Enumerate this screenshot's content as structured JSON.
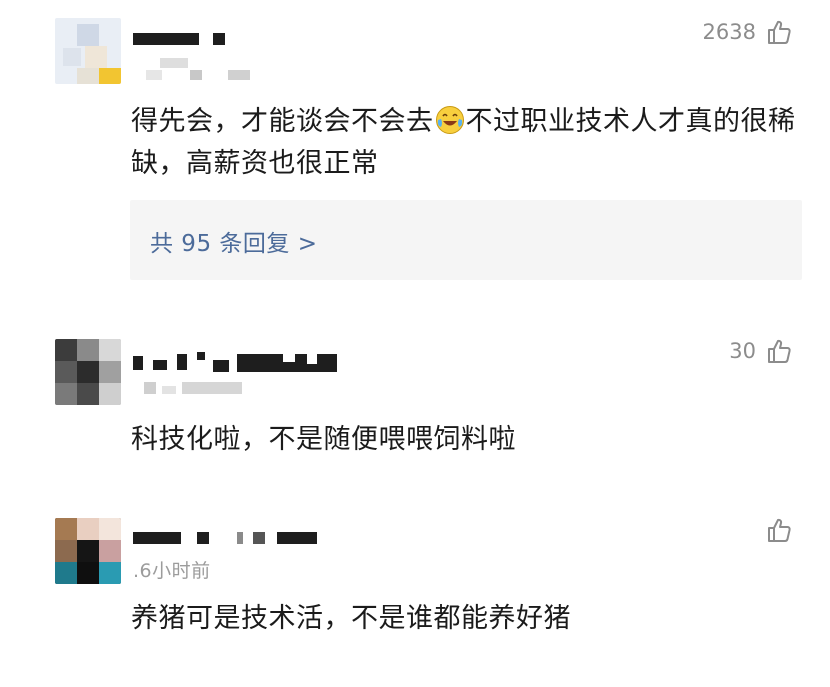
{
  "comments": [
    {
      "likes": "2638",
      "text_parts": [
        "得先会，才能谈会不会去",
        "不过职业技术人才真的很稀缺，高薪资也很正常"
      ],
      "emoji": "laughing-crying-emoji",
      "replies_label": "共 95 条回复 >"
    },
    {
      "likes": "30",
      "text": "科技化啦，不是随便喂喂饲料啦"
    },
    {
      "likes": "",
      "time": ".6小时前",
      "text": "养猪可是技术活，不是谁都能养好猪"
    }
  ],
  "colors": {
    "link": "#4c6b9a",
    "reply_bg": "#f5f5f5",
    "meta": "#9c9c9c"
  }
}
